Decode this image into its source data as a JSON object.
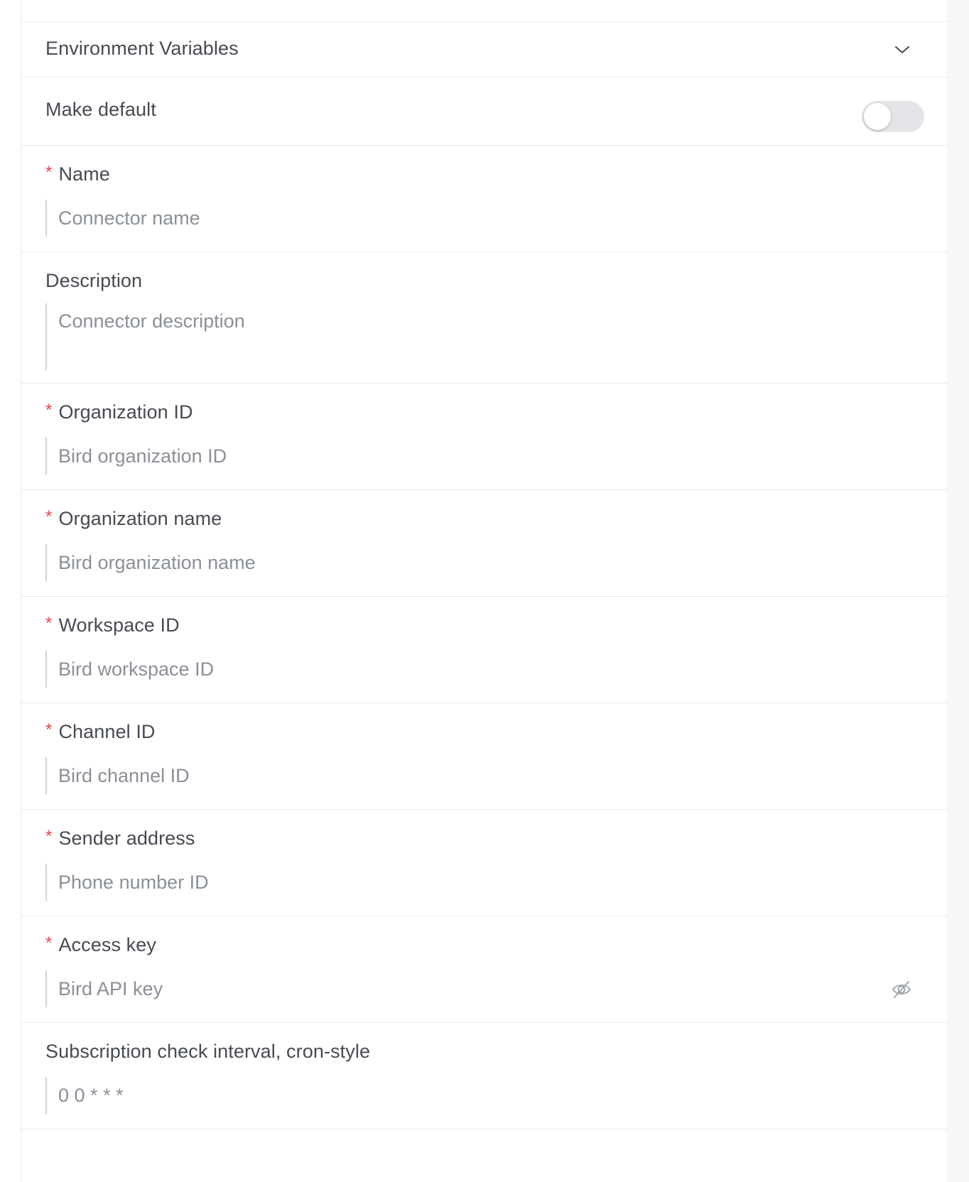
{
  "env_section": {
    "title": "Environment Variables",
    "expand_icon": "chevron-down-icon"
  },
  "make_default": {
    "label": "Make default",
    "enabled": false
  },
  "fields": {
    "name": {
      "label": "Name",
      "required_mark": "*",
      "placeholder": "Connector name",
      "value": ""
    },
    "description": {
      "label": "Description",
      "placeholder": "Connector description",
      "value": ""
    },
    "organization_id": {
      "label": "Organization ID",
      "required_mark": "*",
      "placeholder": "Bird organization ID",
      "value": ""
    },
    "organization_name": {
      "label": "Organization name",
      "required_mark": "*",
      "placeholder": "Bird organization name",
      "value": ""
    },
    "workspace_id": {
      "label": "Workspace ID",
      "required_mark": "*",
      "placeholder": "Bird workspace ID",
      "value": ""
    },
    "channel_id": {
      "label": "Channel ID",
      "required_mark": "*",
      "placeholder": "Bird channel ID",
      "value": ""
    },
    "sender_address": {
      "label": "Sender address",
      "required_mark": "*",
      "placeholder": "Phone number ID",
      "value": ""
    },
    "access_key": {
      "label": "Access key",
      "required_mark": "*",
      "placeholder": "Bird API key",
      "value": "",
      "visibility_icon": "eye-slash-icon"
    },
    "subscription_interval": {
      "label": "Subscription check interval, cron-style",
      "placeholder": "0 0 * * *",
      "value": ""
    }
  },
  "colors": {
    "required": "#e5484d",
    "label": "#464a52",
    "placeholder": "#8a8f98",
    "border": "#e8eaed",
    "toggle_off": "#e3e5e8"
  }
}
